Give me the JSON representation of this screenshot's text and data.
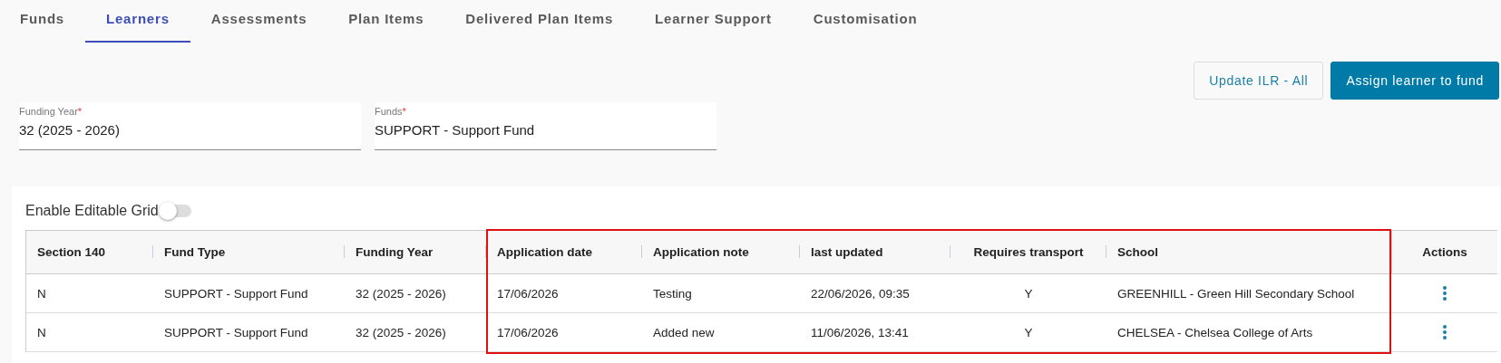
{
  "tabs": [
    {
      "label": "Funds",
      "selected": false
    },
    {
      "label": "Learners",
      "selected": true
    },
    {
      "label": "Assessments",
      "selected": false
    },
    {
      "label": "Plan Items",
      "selected": false
    },
    {
      "label": "Delivered Plan Items",
      "selected": false
    },
    {
      "label": "Learner Support",
      "selected": false
    },
    {
      "label": "Customisation",
      "selected": false
    }
  ],
  "buttons": [
    {
      "label": "Update ILR - All",
      "kind": "outline"
    },
    {
      "label": "Assign learner to fund",
      "kind": "primary"
    }
  ],
  "filters": [
    {
      "label": "Funding Year",
      "required_mark": "*",
      "value": "32 (2025 - 2026)"
    },
    {
      "label": "Funds",
      "required_mark": "*",
      "value": "SUPPORT - Support Fund"
    }
  ],
  "editable_grid": {
    "label": "Enable Editable Grid",
    "on": false
  },
  "table": {
    "columns": [
      {
        "label": "Section 140",
        "highlighted": false
      },
      {
        "label": "Fund Type",
        "highlighted": false
      },
      {
        "label": "Funding Year",
        "highlighted": false
      },
      {
        "label": "Application date",
        "highlighted": true
      },
      {
        "label": "Application note",
        "highlighted": true
      },
      {
        "label": "last updated",
        "highlighted": true
      },
      {
        "label": "Requires transport",
        "highlighted": true
      },
      {
        "label": "School",
        "highlighted": true
      },
      {
        "label": "Actions",
        "highlighted": false
      }
    ],
    "rows": [
      {
        "cells": [
          "N",
          "SUPPORT - Support Fund",
          "32 (2025 - 2026)",
          "17/06/2026",
          "Testing",
          "22/06/2026, 09:35",
          "Y",
          "GREENHILL - Green Hill Secondary School"
        ]
      },
      {
        "cells": [
          "N",
          "SUPPORT - Support Fund",
          "32 (2025 - 2026)",
          "17/06/2026",
          "Added new",
          "11/06/2026, 13:41",
          "Y",
          "CHELSEA - Chelsea College of Arts"
        ]
      }
    ]
  }
}
